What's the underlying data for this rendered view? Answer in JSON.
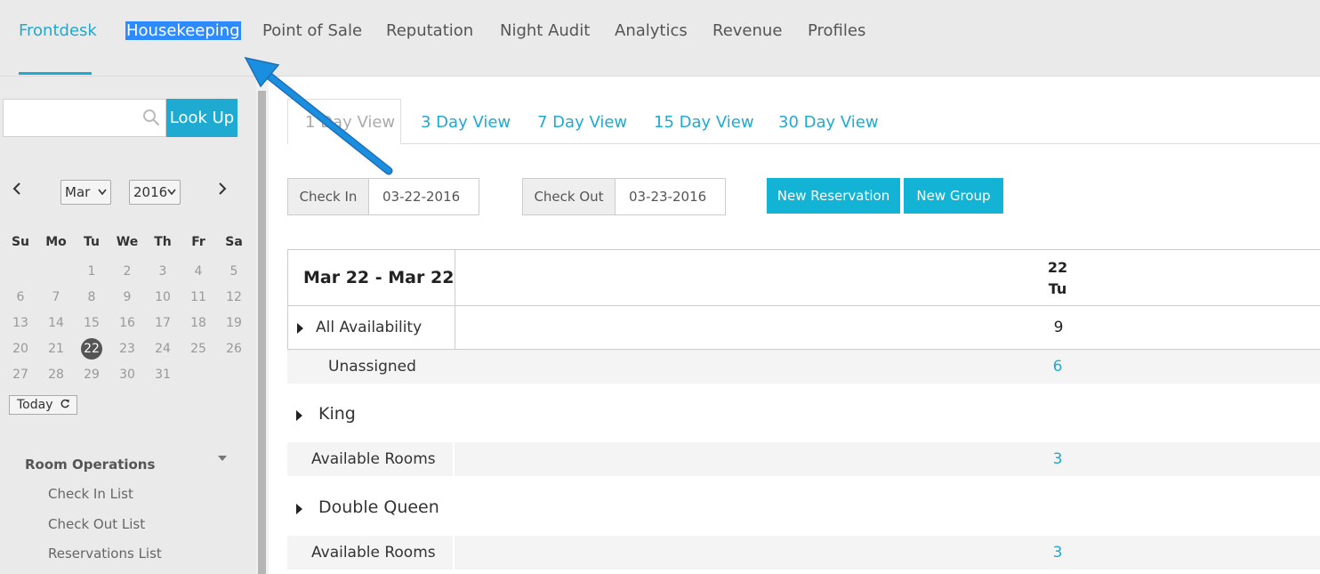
{
  "nav": {
    "items": [
      {
        "label": "Frontdesk"
      },
      {
        "label": "Housekeeping"
      },
      {
        "label": "Point of Sale"
      },
      {
        "label": "Reputation"
      },
      {
        "label": "Night Audit"
      },
      {
        "label": "Analytics"
      },
      {
        "label": "Revenue"
      },
      {
        "label": "Profiles"
      }
    ]
  },
  "sidebar": {
    "search": {
      "value": "",
      "placeholder": ""
    },
    "lookup_label": "Look Up",
    "calendar": {
      "prev": "‹",
      "next": "›",
      "month": "Mar",
      "year": "2016",
      "weekdays": [
        "Su",
        "Mo",
        "Tu",
        "We",
        "Th",
        "Fr",
        "Sa"
      ],
      "selected_day": "22",
      "today_label": "Today"
    },
    "room_ops": {
      "title": "Room Operations",
      "items": [
        "Check In List",
        "Check Out List",
        "Reservations List"
      ]
    }
  },
  "main": {
    "tabs": [
      "1 Day View",
      "3 Day View",
      "7 Day View",
      "15 Day View",
      "30 Day View"
    ],
    "checkin_label": "Check In",
    "checkin_value": "03-22-2016",
    "checkout_label": "Check Out",
    "checkout_value": "03-23-2016",
    "new_reservation": "New Reservation",
    "new_group": "New Group",
    "grid": {
      "range": "Mar 22 - Mar 22",
      "day_number": "22",
      "day_name": "Tu",
      "rows": {
        "all_availability": {
          "label": "All Availability",
          "value": "9"
        },
        "unassigned": {
          "label": "Unassigned",
          "value": "6"
        },
        "king": {
          "label": "King"
        },
        "king_available": {
          "label": "Available Rooms",
          "value": "3"
        },
        "double_queen": {
          "label": "Double Queen"
        },
        "dq_available": {
          "label": "Available Rooms",
          "value": "3"
        }
      }
    }
  },
  "colors": {
    "accent": "#1eaad1",
    "button": "#12b3d4",
    "highlight": "#2e8bff",
    "annotation_arrow": "#1a8fe0"
  }
}
